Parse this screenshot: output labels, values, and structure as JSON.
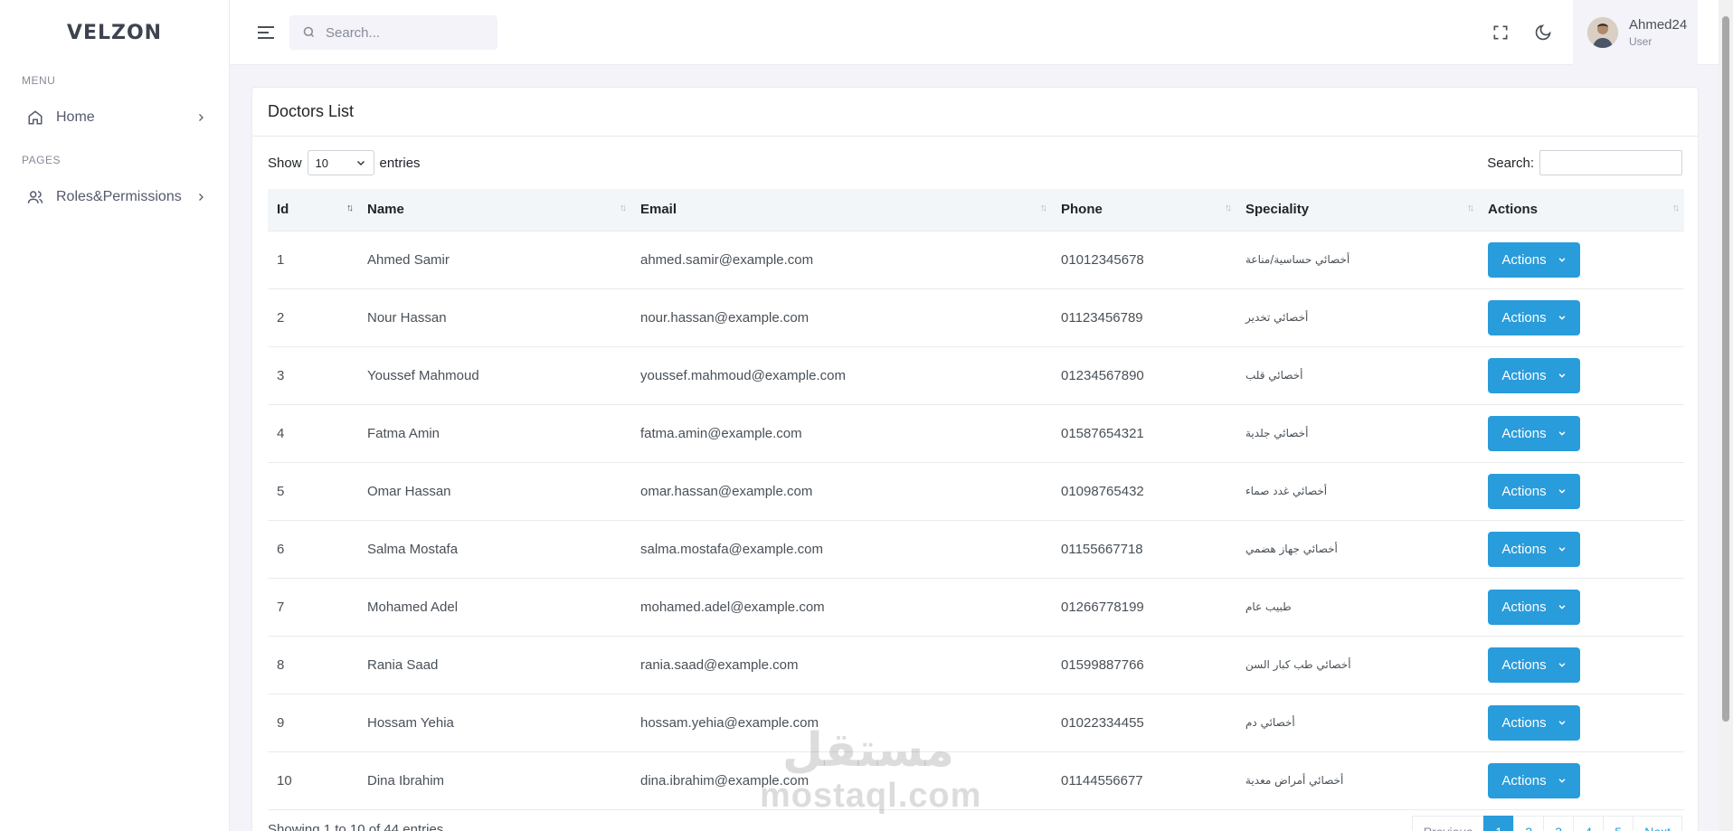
{
  "sidebar": {
    "logo": "VELZON",
    "menu_title": "MENU",
    "home_label": "Home",
    "pages_title": "PAGES",
    "roles_label": "Roles&Permissions"
  },
  "topbar": {
    "search_placeholder": "Search...",
    "user_name": "Ahmed24",
    "user_role": "User"
  },
  "card": {
    "title": "Doctors List",
    "show_label": "Show",
    "page_length": "10",
    "entries_label": "entries",
    "search_label": "Search:"
  },
  "table": {
    "columns": [
      "Id",
      "Name",
      "Email",
      "Phone",
      "Speciality",
      "Actions"
    ],
    "rows": [
      {
        "id": "1",
        "name": "Ahmed Samir",
        "email": "ahmed.samir@example.com",
        "phone": "01012345678",
        "speciality": "أخصائي حساسية/مناعة",
        "action": "Actions"
      },
      {
        "id": "2",
        "name": "Nour Hassan",
        "email": "nour.hassan@example.com",
        "phone": "01123456789",
        "speciality": "أخصائي تخدير",
        "action": "Actions"
      },
      {
        "id": "3",
        "name": "Youssef Mahmoud",
        "email": "youssef.mahmoud@example.com",
        "phone": "01234567890",
        "speciality": "أخصائي قلب",
        "action": "Actions"
      },
      {
        "id": "4",
        "name": "Fatma Amin",
        "email": "fatma.amin@example.com",
        "phone": "01587654321",
        "speciality": "أخصائي جلدية",
        "action": "Actions"
      },
      {
        "id": "5",
        "name": "Omar Hassan",
        "email": "omar.hassan@example.com",
        "phone": "01098765432",
        "speciality": "أخصائي غدد صماء",
        "action": "Actions"
      },
      {
        "id": "6",
        "name": "Salma Mostafa",
        "email": "salma.mostafa@example.com",
        "phone": "01155667718",
        "speciality": "أخصائي جهاز هضمي",
        "action": "Actions"
      },
      {
        "id": "7",
        "name": "Mohamed Adel",
        "email": "mohamed.adel@example.com",
        "phone": "01266778199",
        "speciality": "طبيب عام",
        "action": "Actions"
      },
      {
        "id": "8",
        "name": "Rania Saad",
        "email": "rania.saad@example.com",
        "phone": "01599887766",
        "speciality": "أخصائي طب كبار السن",
        "action": "Actions"
      },
      {
        "id": "9",
        "name": "Hossam Yehia",
        "email": "hossam.yehia@example.com",
        "phone": "01022334455",
        "speciality": "أخصائي دم",
        "action": "Actions"
      },
      {
        "id": "10",
        "name": "Dina Ibrahim",
        "email": "dina.ibrahim@example.com",
        "phone": "01144556677",
        "speciality": "أخصائي أمراض معدية",
        "action": "Actions"
      }
    ]
  },
  "footer": {
    "info": "Showing 1 to 10 of 44 entries",
    "previous": "Previous",
    "pages": [
      "1",
      "2",
      "3",
      "4",
      "5"
    ],
    "next": "Next"
  },
  "watermark": {
    "arabic": "مستقل",
    "latin": "mostaql.com"
  },
  "colors": {
    "primary": "#299cdb",
    "background": "#f3f3f9"
  }
}
